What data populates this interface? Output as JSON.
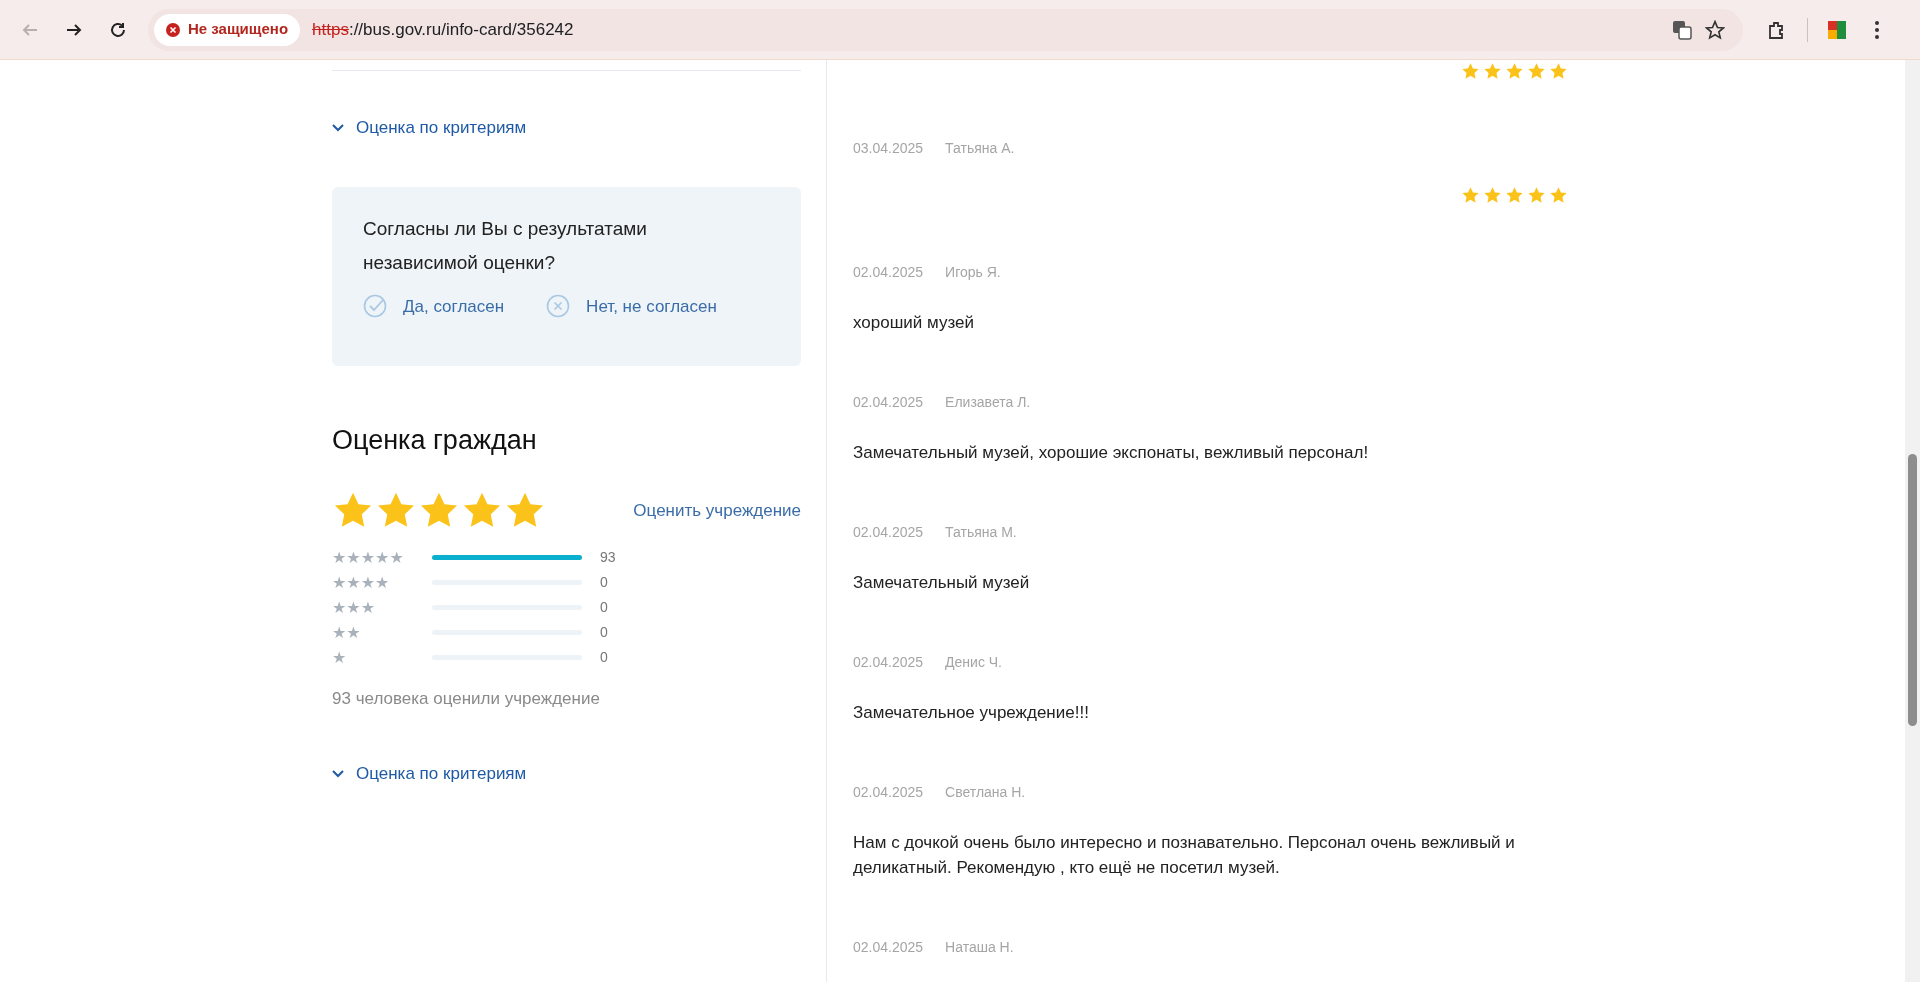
{
  "browser": {
    "back_disabled": true,
    "security": "Не защищено",
    "url_scheme": "https",
    "url_rest": "://bus.gov.ru/info-card/356242"
  },
  "left": {
    "criteria_link_top": "Оценка по критериям",
    "agree_box": {
      "question": "Согласны ли Вы с результатами независимой оценки?",
      "options": [
        {
          "kind": "yes",
          "label": "Да, согласен"
        },
        {
          "kind": "no",
          "label": "Нет, не согласен"
        }
      ]
    },
    "citizens": {
      "title": "Оценка граждан",
      "stars": 5,
      "rate_link": "Оценить учреждение",
      "distribution": [
        {
          "label": "★★★★★",
          "level": 1,
          "count": "93"
        },
        {
          "label": "★★★★",
          "level": 0,
          "count": "0"
        },
        {
          "label": "★★★",
          "level": 0,
          "count": "0"
        },
        {
          "label": "★★",
          "level": 0,
          "count": "0"
        },
        {
          "label": "★",
          "level": 0,
          "count": "0"
        }
      ],
      "total": "93 человека оценили учреждение"
    },
    "criteria_link_bottom": "Оценка по критериям"
  },
  "reviews": [
    {
      "stars": 5
    },
    {
      "date": "03.04.2025",
      "author": "Татьяна А.",
      "stars": 5
    },
    {
      "date": "02.04.2025",
      "author": "Игорь Я.",
      "text": "хороший музей"
    },
    {
      "date": "02.04.2025",
      "author": "Елизавета Л.",
      "text": "Замечательный музей, хорошие экспонаты, вежливый персонал!"
    },
    {
      "date": "02.04.2025",
      "author": "Татьяна М.",
      "text": "Замечательный музей"
    },
    {
      "date": "02.04.2025",
      "author": "Денис Ч.",
      "text": "Замечательное учреждение!!!"
    },
    {
      "date": "02.04.2025",
      "author": "Светлана Н.",
      "text": "Нам с дочкой очень было интересно и познавательно. Персонал очень вежливый и деликатный. Рекомендую , кто ещё не посетил музей."
    },
    {
      "date": "02.04.2025",
      "author": "Наташа Н."
    }
  ]
}
